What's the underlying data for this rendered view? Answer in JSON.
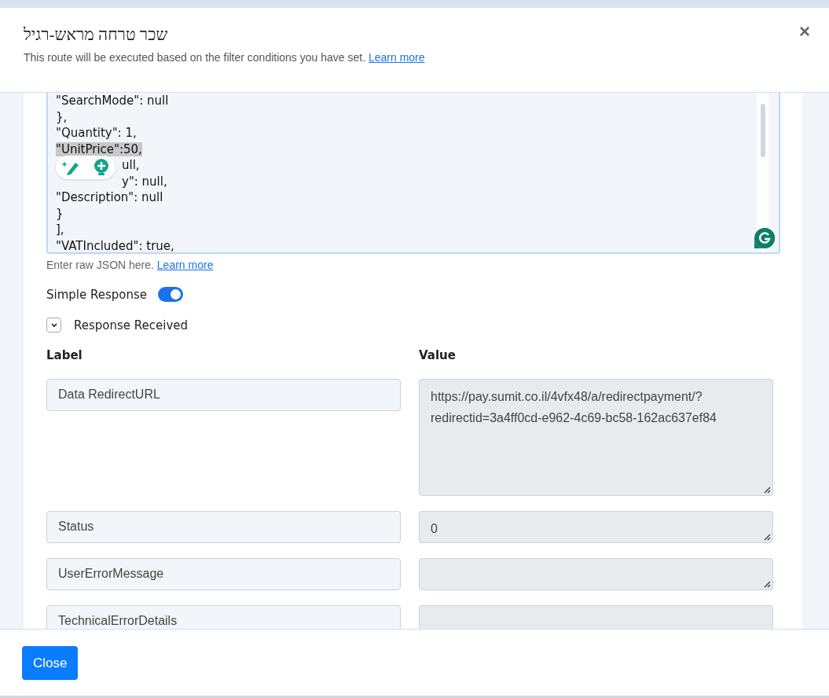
{
  "header": {
    "title": "שכר טרחה מראש-רגיל",
    "subtitle": "This route will be executed based on the filter conditions you have set.",
    "subtitle_link": "Learn more",
    "close": "×"
  },
  "editor": {
    "lines": [
      {
        "text": "\"SearchMode\": null",
        "highlighted": false,
        "indented": false
      },
      {
        "text": "},",
        "highlighted": false,
        "indented": false
      },
      {
        "text": "\"Quantity\": 1,",
        "highlighted": false,
        "indented": false
      },
      {
        "text": "\"UnitPrice\":50,",
        "highlighted": true,
        "indented": false
      },
      {
        "text": "ull,",
        "highlighted": false,
        "indented": true
      },
      {
        "text": "y\": null,",
        "highlighted": false,
        "indented": true
      },
      {
        "text": "\"Description\": null",
        "highlighted": false,
        "indented": false
      },
      {
        "text": "}",
        "highlighted": false,
        "indented": false
      },
      {
        "text": "],",
        "highlighted": false,
        "indented": false
      },
      {
        "text": "\"VATIncluded\": true,",
        "highlighted": false,
        "indented": false
      }
    ],
    "hint": "Enter raw JSON here.",
    "hint_link": "Learn more"
  },
  "simple_response": {
    "label": "Simple Response",
    "on": true
  },
  "response_received": {
    "label": "Response Received",
    "expanded": true
  },
  "table": {
    "columns": [
      "Label",
      "Value"
    ],
    "rows": [
      {
        "label": "Data RedirectURL",
        "value": "https://pay.sumit.co.il/4vfx48/a/redirectpayment/?redirectid=3a4ff0cd-e962-4c69-bc58-162ac637ef84",
        "kind": "tall"
      },
      {
        "label": "Status",
        "value": "0",
        "kind": "short"
      },
      {
        "label": "UserErrorMessage",
        "kind": "short"
      },
      {
        "label": "TechnicalErrorDetails",
        "kind": "cut"
      }
    ]
  },
  "footer": {
    "button": "Close"
  }
}
